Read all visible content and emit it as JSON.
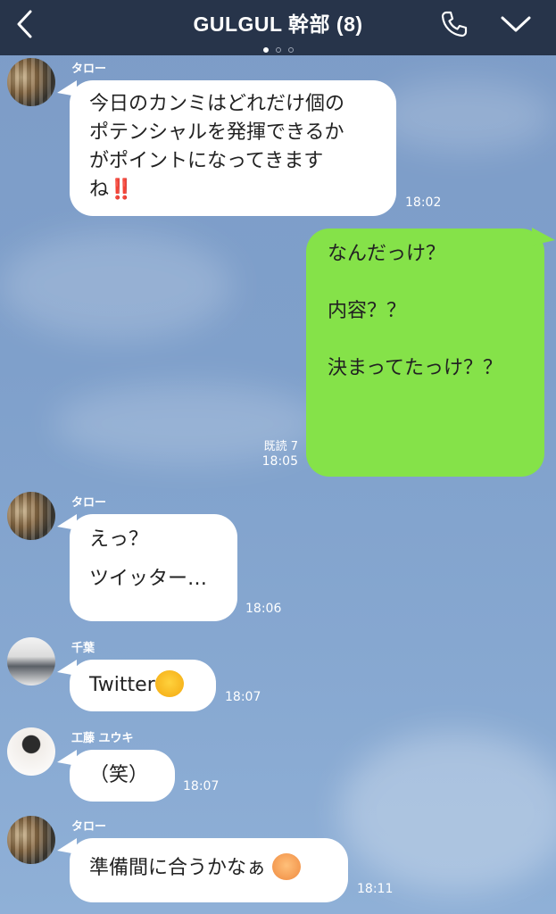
{
  "header": {
    "title": "GULGUL 幹部 (8)",
    "page_dots": 3,
    "active_dot": 0,
    "colors": {
      "bar": "#27344a",
      "text": "#ffffff"
    }
  },
  "messages": [
    {
      "sender": "タロー",
      "lines": [
        "今日のカンミはどれだけ個の",
        "ポテンシャルを発揮できるか",
        "がポイントになってきます",
        "ね"
      ],
      "emoji": "‼️",
      "time": "18:02"
    },
    {
      "mine": true,
      "lines": [
        "なんだっけ？",
        "",
        "",
        "内容？？",
        "",
        "",
        "",
        "決まってたっけ？？"
      ],
      "read": "既読 7",
      "time": "18:05"
    },
    {
      "sender": "タロー",
      "lines": [
        "えっ？",
        "",
        "ツイッター…"
      ],
      "time": "18:06"
    },
    {
      "sender": "千葉",
      "text": "Twitter",
      "emoji": "😂",
      "time": "18:07"
    },
    {
      "sender": "工藤 ユウキ",
      "text": "（笑）",
      "time": "18:07"
    },
    {
      "sender": "タロー",
      "text": "準備間に合うかなぁ",
      "emoji": "🥵",
      "time": "18:11"
    }
  ],
  "icons": [
    "back-icon",
    "phone-icon",
    "chevron-down-icon"
  ],
  "colors": {
    "own_bubble": "#85e249",
    "other_bubble": "#ffffff",
    "background": "#7fa0cb"
  }
}
